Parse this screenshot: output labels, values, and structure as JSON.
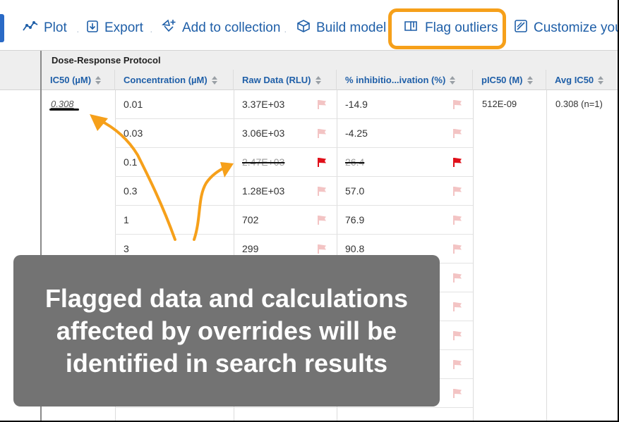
{
  "toolbar": {
    "items": [
      {
        "label": "Plot",
        "icon": "plot-icon"
      },
      {
        "label": "Export",
        "icon": "export-icon"
      },
      {
        "label": "Add to collection",
        "icon": "add-to-collection-icon"
      },
      {
        "label": "Build model",
        "icon": "cube-icon"
      },
      {
        "label": "Flag outliers",
        "icon": "flag-book-icon"
      },
      {
        "label": "Customize you",
        "icon": "customize-icon"
      }
    ],
    "highlight_color": "#f6a01a"
  },
  "table": {
    "protocol": "Dose-Response Protocol",
    "columns": [
      "IC50 (µM)",
      "Concentration (µM)",
      "Raw Data (RLU)",
      "% inhibitio...ivation (%)",
      "pIC50 (M)",
      "Avg IC50"
    ],
    "ic50_value": "0.308",
    "pic50_value": "512E-09",
    "avg_ic50_value": "0.308 (n=1)",
    "rows": [
      {
        "concentration": "0.01",
        "raw": "3.37E+03",
        "inhibition": "-14.9",
        "flagged": false
      },
      {
        "concentration": "0.03",
        "raw": "3.06E+03",
        "inhibition": "-4.25",
        "flagged": false
      },
      {
        "concentration": "0.1",
        "raw": "2.47E+03",
        "inhibition": "26.4",
        "flagged": true
      },
      {
        "concentration": "0.3",
        "raw": "1.28E+03",
        "inhibition": "57.0",
        "flagged": false
      },
      {
        "concentration": "1",
        "raw": "702",
        "inhibition": "76.9",
        "flagged": false
      },
      {
        "concentration": "3",
        "raw": "299",
        "inhibition": "90.8",
        "flagged": false
      },
      {
        "concentration": "",
        "raw": "",
        "inhibition": "",
        "flagged": false
      },
      {
        "concentration": "",
        "raw": "",
        "inhibition": "",
        "flagged": false
      },
      {
        "concentration": "",
        "raw": "",
        "inhibition": "",
        "flagged": false
      },
      {
        "concentration": "",
        "raw": "",
        "inhibition": "",
        "flagged": false
      },
      {
        "concentration": "",
        "raw": "",
        "inhibition": "",
        "flagged": false
      }
    ],
    "flag_color_inactive": "#f3c4c4",
    "flag_color_active": "#e0101a"
  },
  "callout": {
    "text": "Flagged data and calculations affected by overrides will be identified in search results",
    "background": "#737373",
    "arrow_color": "#f6a01a"
  }
}
